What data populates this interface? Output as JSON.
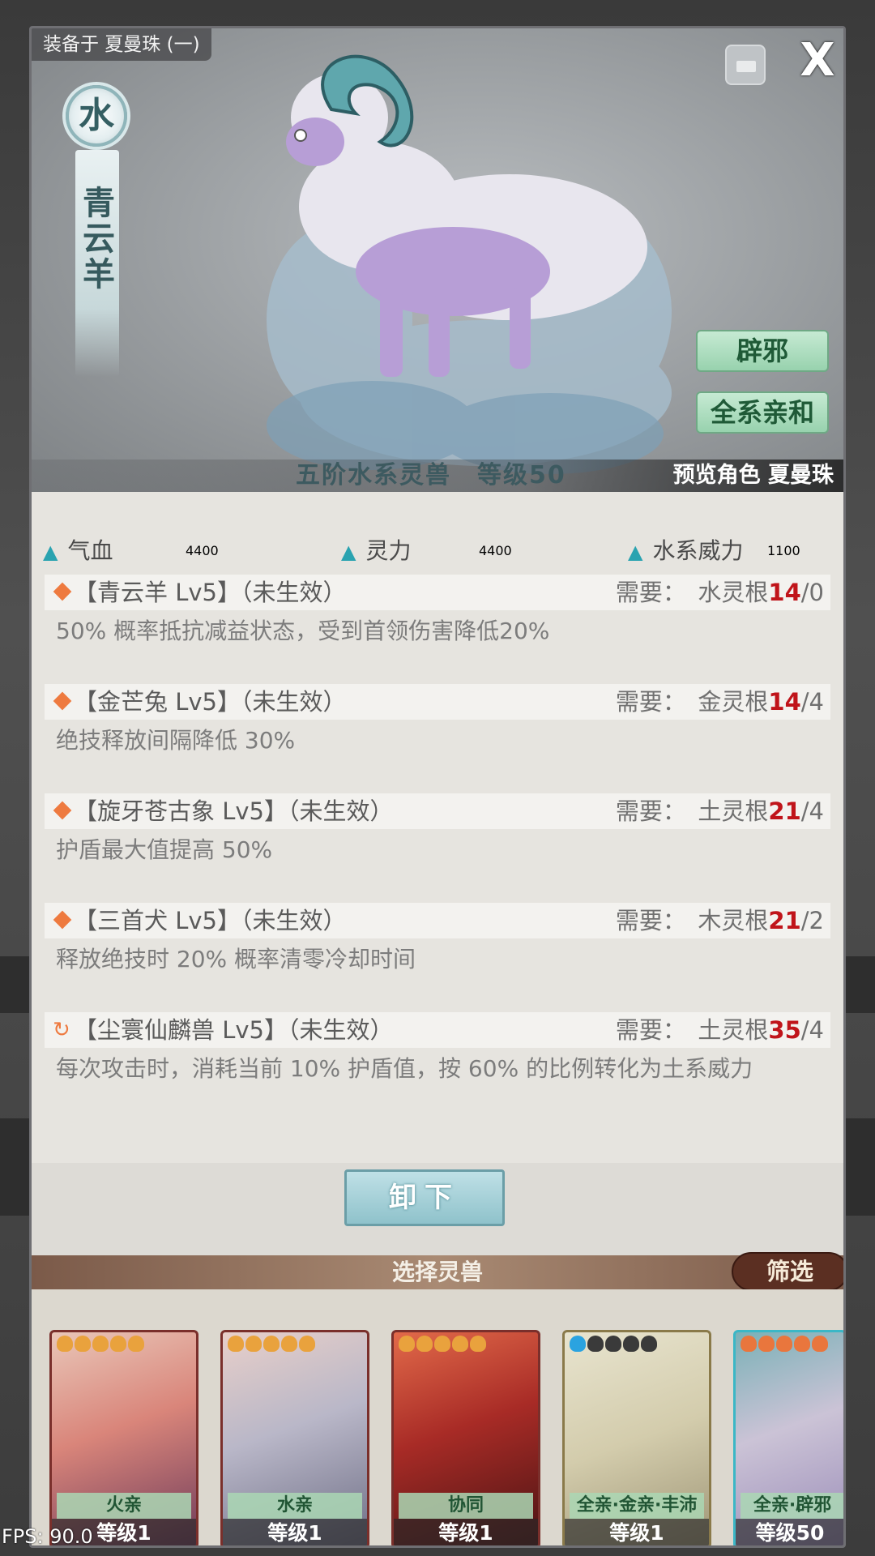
{
  "equip_tag": "装备于 夏曼珠 (一)",
  "element_badge": "水",
  "beast_name": "青云羊",
  "tags": [
    "辟邪",
    "全系亲和"
  ],
  "tier_text": "五阶水系灵兽　等级50",
  "preview_text": "预览角色 夏曼珠",
  "stats": [
    {
      "label": "气血",
      "value": "4400"
    },
    {
      "label": "灵力",
      "value": "4400"
    },
    {
      "label": "水系威力",
      "value": "1100"
    }
  ],
  "skills": [
    {
      "icon": "diamond",
      "name": "【青云羊 Lv5】（未生效）",
      "req_prefix": "需要：　水灵根",
      "req_need": "14",
      "req_have": "/0",
      "desc": "50% 概率抵抗减益状态，受到首领伤害降低20%"
    },
    {
      "icon": "diamond",
      "name": "【金芒兔 Lv5】（未生效）",
      "req_prefix": "需要：　金灵根",
      "req_need": "14",
      "req_have": "/4",
      "desc": "绝技释放间隔降低 30%"
    },
    {
      "icon": "diamond",
      "name": "【旋牙苍古象 Lv5】（未生效）",
      "req_prefix": "需要：　土灵根",
      "req_need": "21",
      "req_have": "/4",
      "desc": "护盾最大值提高 50%"
    },
    {
      "icon": "diamond",
      "name": "【三首犬 Lv5】（未生效）",
      "req_prefix": "需要：　木灵根",
      "req_need": "21",
      "req_have": "/2",
      "desc": "释放绝技时 20% 概率清零冷却时间"
    },
    {
      "icon": "cycle",
      "name": "【尘寰仙麟兽 Lv5】（未生效）",
      "req_prefix": "需要：　土灵根",
      "req_need": "35",
      "req_have": "/4",
      "desc": "每次攻击时，消耗当前 10% 护盾值，按 60% 的比例转化为土系威力"
    }
  ],
  "unload_label": "卸下",
  "select_title": "选择灵兽",
  "filter_label": "筛选",
  "cards": [
    {
      "affinity": "火亲",
      "level": "等级1",
      "stars": 5,
      "star_color": "#e9a23d"
    },
    {
      "affinity": "水亲",
      "level": "等级1",
      "stars": 5,
      "star_color": "#e9a23d"
    },
    {
      "affinity": "协同",
      "level": "等级1",
      "stars": 5,
      "star_color": "#e9a23d"
    },
    {
      "affinity": "全亲·金亲·丰沛",
      "level": "等级1",
      "stars": 1,
      "star_color": "#2aa3e0"
    },
    {
      "affinity": "全亲·辟邪",
      "level": "等级50",
      "stars": 5,
      "star_color": "#e9763d"
    }
  ],
  "fps": "FPS: 90.0",
  "colors": {
    "accent_teal": "#2aa3b0",
    "need_red": "#c0141a",
    "tag_green": "#98d2ae",
    "filter_brown": "#5b2f22"
  }
}
